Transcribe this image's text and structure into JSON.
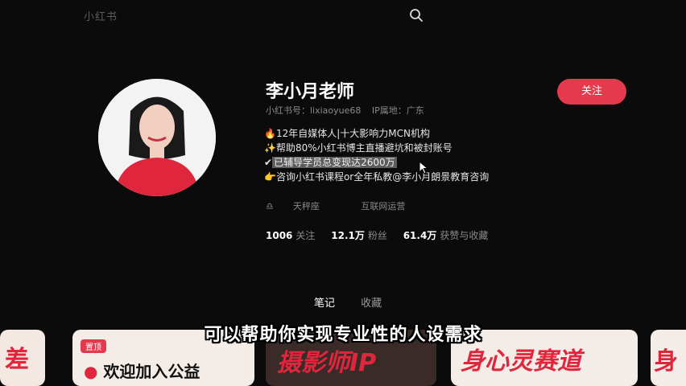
{
  "header": {
    "logo_text": "小红书"
  },
  "profile": {
    "name": "李小月老师",
    "id_label": "小红书号：lixiaoyue68",
    "ip_label": "IP属地：广东",
    "follow_label": "关注",
    "bio": [
      "12年自媒体人|十大影响力MCN机构",
      "帮助80%小红书博主直播避坑和被封账号",
      "已辅导学员总变现达2600万",
      "咨询小红书课程or全年私教@李小月朗景教育咨询"
    ],
    "tags": [
      "天秤座",
      "互联网运营"
    ],
    "stats": [
      {
        "value": "1006",
        "label": "关注"
      },
      {
        "value": "12.1万",
        "label": "粉丝"
      },
      {
        "value": "61.4万",
        "label": "获赞与收藏"
      }
    ]
  },
  "tabs": [
    {
      "label": "笔记",
      "active": true
    },
    {
      "label": "收藏",
      "active": false
    }
  ],
  "cards": [
    {
      "title": "差"
    },
    {
      "badge": "置顶",
      "title": "欢迎加入公益"
    },
    {
      "title": "摄影师IP"
    },
    {
      "title": "身心灵赛道"
    },
    {
      "title": "身"
    }
  ],
  "subtitle": "可以帮助你实现专业性的人设需求",
  "colors": {
    "accent": "#e53a4d",
    "background": "#0b0b0b"
  }
}
